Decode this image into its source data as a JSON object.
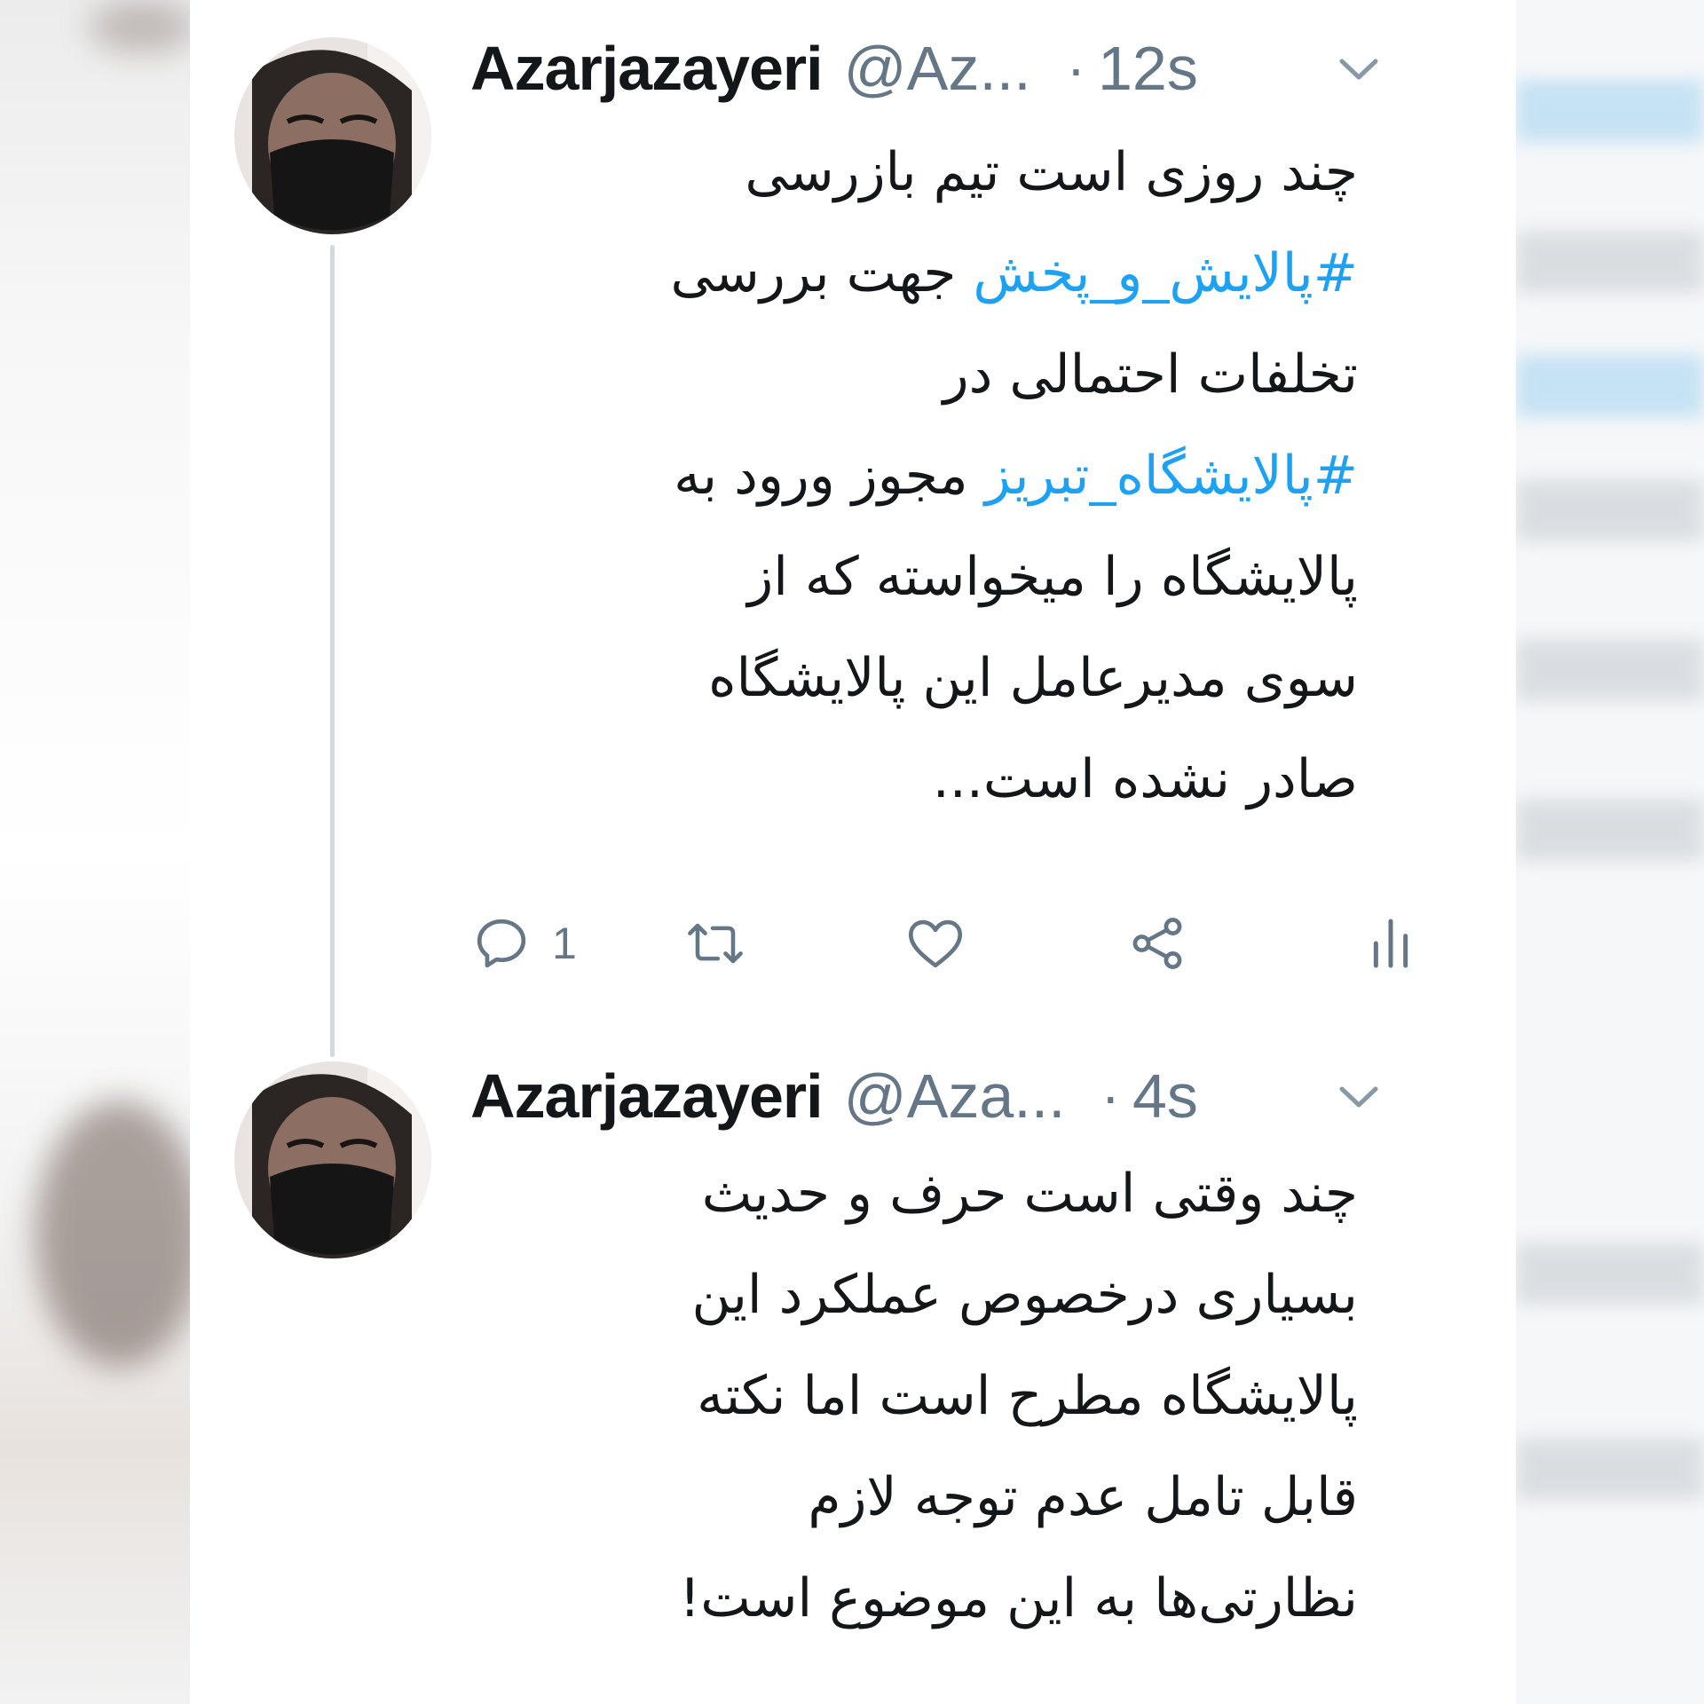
{
  "tweets": [
    {
      "name": "Azarjazayeri",
      "handle": "@Az...",
      "dot": "·",
      "time": "12s",
      "lines": [
        [
          {
            "t": "چند روزی است  تیم بازرسی"
          }
        ],
        [
          {
            "t": "#پالایش_و_پخش",
            "tag": true
          },
          {
            "t": " جهت بررسی"
          }
        ],
        [
          {
            "t": "تخلفات احتمالی در"
          }
        ],
        [
          {
            "t": "#پالایشگاه_تبریز",
            "tag": true
          },
          {
            "t": " مجوز ورود به"
          }
        ],
        [
          {
            "t": "پالایشگاه را میخواسته که  از"
          }
        ],
        [
          {
            "t": "سوی مدیرعامل این پالایشگاه"
          }
        ],
        [
          {
            "t": "صادر نشده است..."
          }
        ]
      ],
      "reply_count": "1"
    },
    {
      "name": "Azarjazayeri",
      "handle": "@Aza...",
      "dot": "·",
      "time": "4s",
      "lines": [
        [
          {
            "t": "چند وقتی است حرف و حدیث"
          }
        ],
        [
          {
            "t": "بسیاری درخصوص  عملکرد این"
          }
        ],
        [
          {
            "t": "پالایشگاه مطرح است اما نکته"
          }
        ],
        [
          {
            "t": "قابل تامل عدم توجه لازم"
          }
        ],
        [
          {
            "t": "نظارتی‌ها به این موضوع است!"
          }
        ]
      ]
    }
  ],
  "icons": {
    "reply": "reply-icon",
    "retweet": "retweet-icon",
    "like": "like-icon",
    "share": "share-icon",
    "analytics": "analytics-icon",
    "menu": "chevron-down-icon"
  },
  "colors": {
    "text": "#14171a",
    "secondary": "#657786",
    "hashtag": "#1da1f2",
    "thread_line": "#cfd9de"
  }
}
